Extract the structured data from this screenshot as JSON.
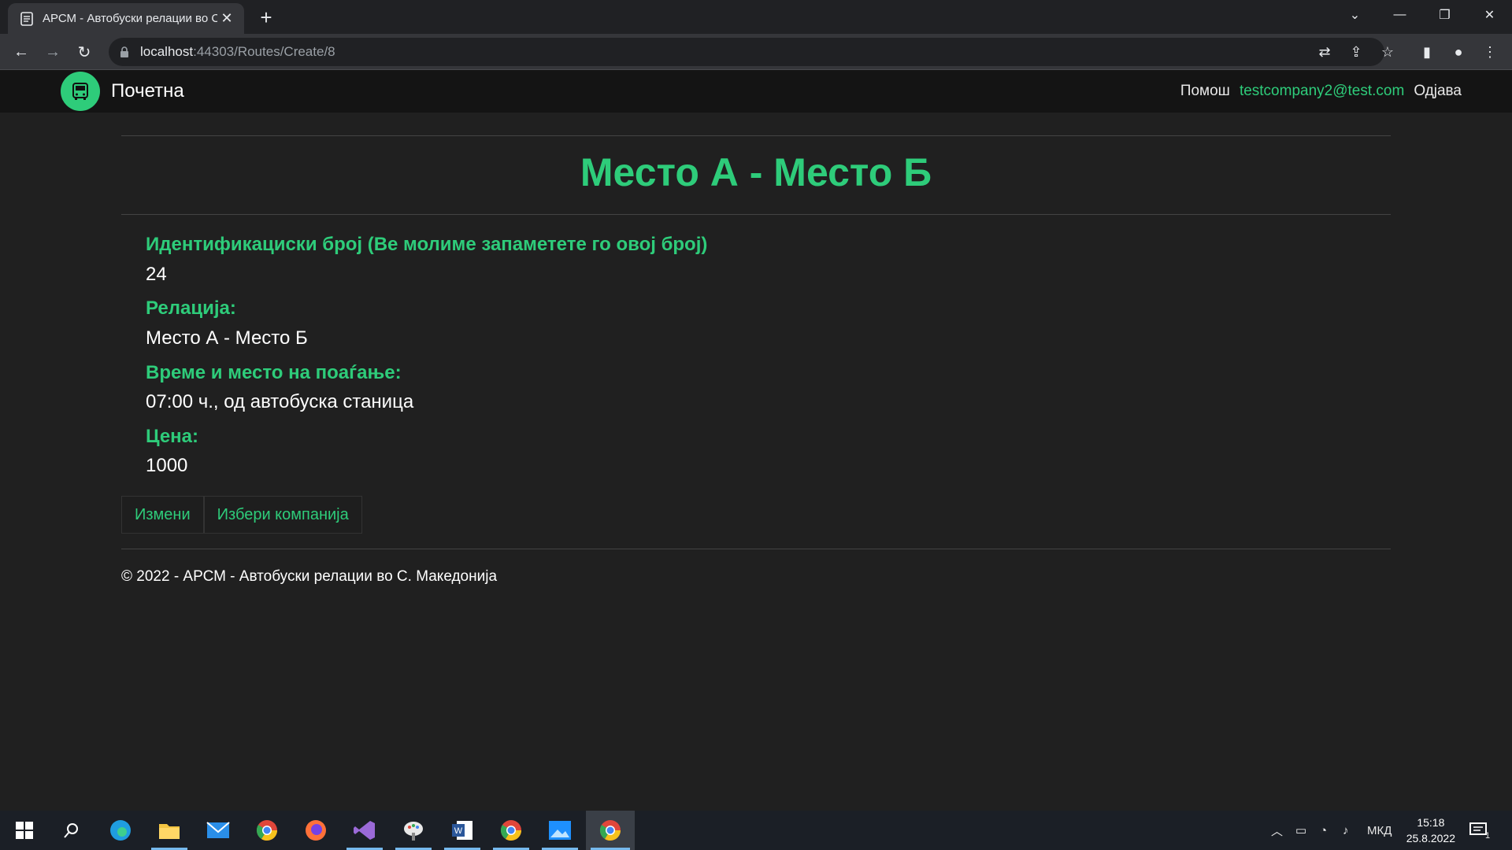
{
  "browser": {
    "tab_title": "АРСМ - Автобуски релации во С",
    "url_host": "localhost",
    "url_path": ":44303/Routes/Create/8"
  },
  "site": {
    "brand": "Почетна",
    "nav_help": "Помош",
    "nav_user": "testcompany2@test.com",
    "nav_logout": "Одјава"
  },
  "page": {
    "title": "Место А - Место Б",
    "fields": [
      {
        "label": "Идентификациски број (Ве молиме запаметете го овој број)",
        "value": "24"
      },
      {
        "label": "Релација:",
        "value": "Место А - Место Б"
      },
      {
        "label": "Време и место на поаѓање:",
        "value": "07:00 ч., од автобуска станица"
      },
      {
        "label": "Цена:",
        "value": "1000"
      }
    ],
    "edit_button": "Измени",
    "choose_company_button": "Избери компанија",
    "footer": "© 2022 - АРСМ - Автобуски релации во С. Македонија"
  },
  "taskbar": {
    "language": "МКД",
    "time": "15:18",
    "date": "25.8.2022",
    "notification_count": "1"
  },
  "colors": {
    "accent": "#2ecc7a",
    "background": "#202020"
  }
}
